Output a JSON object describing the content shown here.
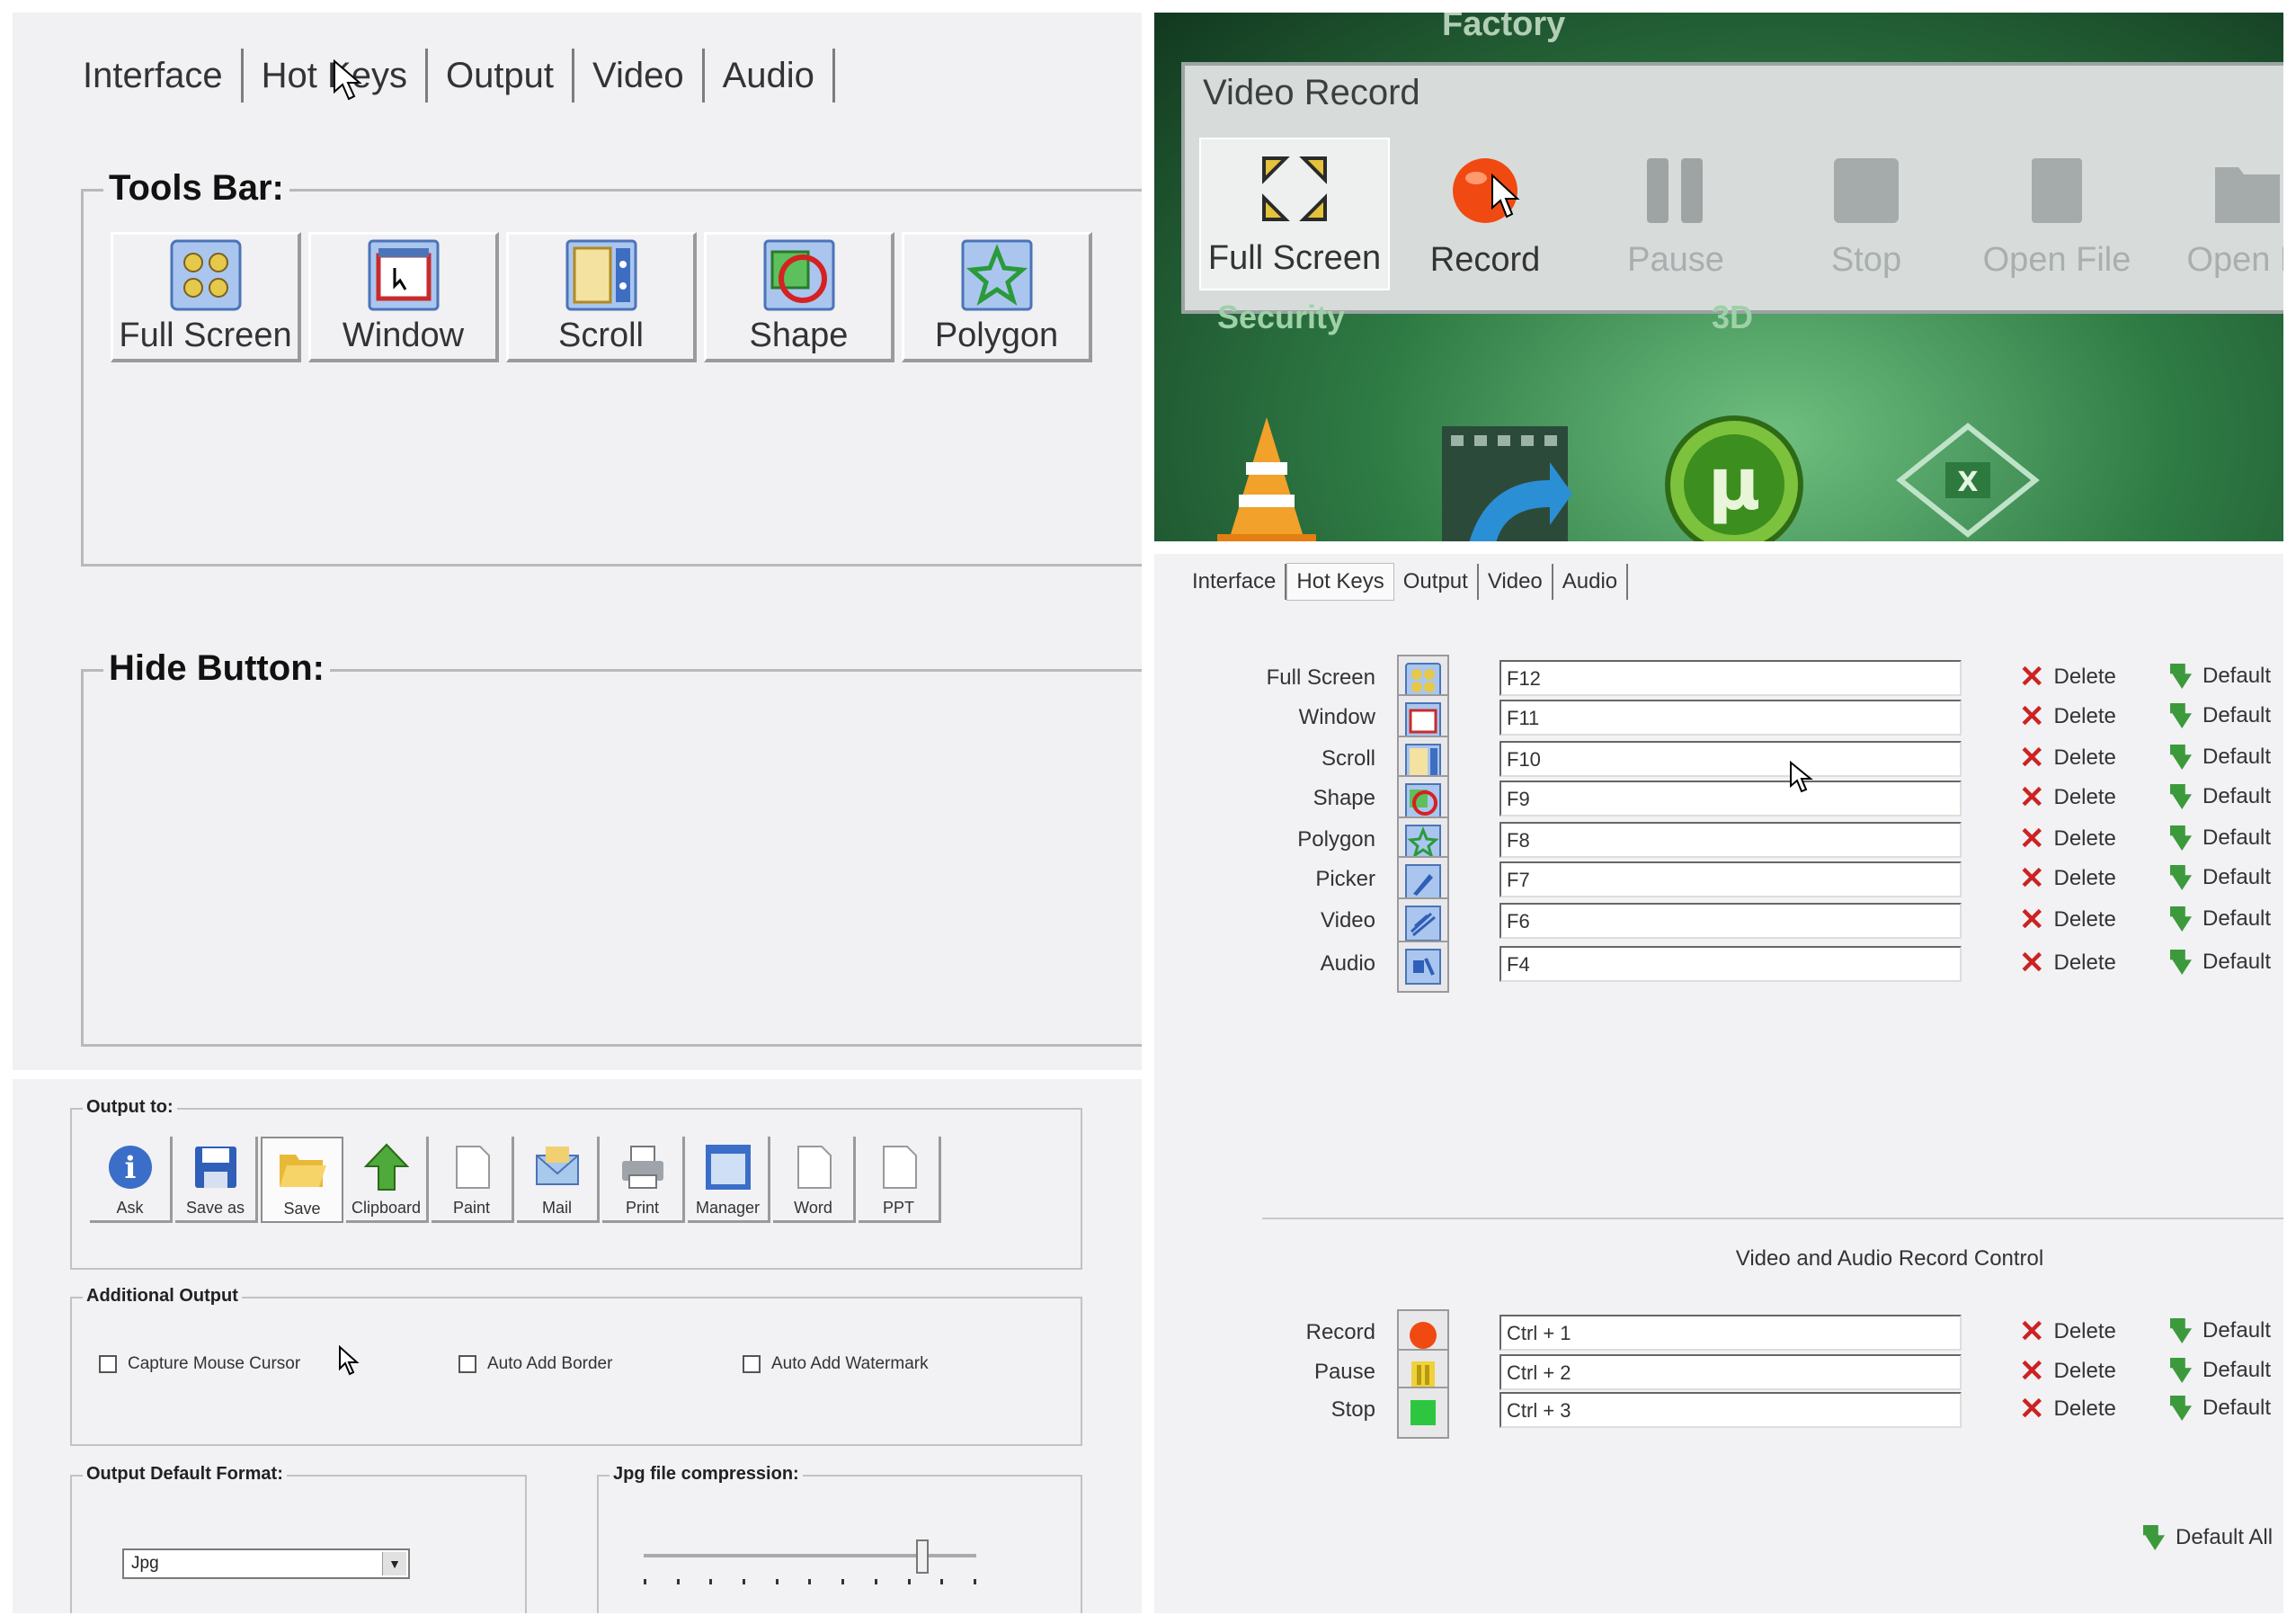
{
  "interface_panel": {
    "tabs": [
      "Interface",
      "Hot Keys",
      "Output",
      "Video",
      "Audio"
    ],
    "tools_bar_label": "Tools Bar:",
    "tools": [
      {
        "label": "Full Screen",
        "icon": "full-screen-icon"
      },
      {
        "label": "Window",
        "icon": "window-icon"
      },
      {
        "label": "Scroll",
        "icon": "scroll-icon"
      },
      {
        "label": "Shape",
        "icon": "shape-icon"
      },
      {
        "label": "Polygon",
        "icon": "polygon-icon"
      }
    ],
    "hide_button_label": "Hide Button:"
  },
  "video_record": {
    "title": "Video Record",
    "background_label": "Factory",
    "buttons": [
      {
        "label": "Full Screen",
        "icon": "full-screen-icon",
        "enabled": true
      },
      {
        "label": "Record",
        "icon": "record-icon",
        "enabled": true
      },
      {
        "label": "Pause",
        "icon": "pause-icon",
        "enabled": false
      },
      {
        "label": "Stop",
        "icon": "stop-icon",
        "enabled": false
      },
      {
        "label": "Open File",
        "icon": "open-file-icon",
        "enabled": false
      },
      {
        "label": "Open Fi",
        "icon": "open-folder-icon",
        "enabled": false
      }
    ],
    "desktop_labels": [
      "Security",
      "3D"
    ],
    "desktop_icons": [
      "vlc-icon",
      "video-converter-icon",
      "utorrent-icon",
      "excel-icon"
    ]
  },
  "output_panel": {
    "output_to_label": "Output to:",
    "output_buttons": [
      {
        "label": "Ask",
        "icon": "info-icon"
      },
      {
        "label": "Save as",
        "icon": "save-icon"
      },
      {
        "label": "Save",
        "icon": "folder-icon",
        "selected": true
      },
      {
        "label": "Clipboard",
        "icon": "clipboard-icon"
      },
      {
        "label": "Paint",
        "icon": "paint-icon"
      },
      {
        "label": "Mail",
        "icon": "mail-icon"
      },
      {
        "label": "Print",
        "icon": "printer-icon"
      },
      {
        "label": "Manager",
        "icon": "manager-icon"
      },
      {
        "label": "Word",
        "icon": "word-icon"
      },
      {
        "label": "PPT",
        "icon": "ppt-icon"
      }
    ],
    "additional_output_label": "Additional Output",
    "checkboxes": [
      {
        "label": "Capture Mouse Cursor",
        "checked": false
      },
      {
        "label": "Auto Add Border",
        "checked": false
      },
      {
        "label": "Auto Add Watermark",
        "checked": false
      }
    ],
    "default_format_label": "Output Default Format:",
    "default_format_value": "Jpg",
    "jpg_compression_label": "Jpg file compression:",
    "jpg_compression_level": 0.82
  },
  "hotkeys_panel": {
    "tabs": [
      "Interface",
      "Hot Keys",
      "Output",
      "Video",
      "Audio"
    ],
    "rows": [
      {
        "label": "Full Screen",
        "key": "F12",
        "icon": "full-screen-icon"
      },
      {
        "label": "Window",
        "key": "F11",
        "icon": "window-icon"
      },
      {
        "label": "Scroll",
        "key": "F10",
        "icon": "scroll-icon"
      },
      {
        "label": "Shape",
        "key": "F9",
        "icon": "shape-icon"
      },
      {
        "label": "Polygon",
        "key": "F8",
        "icon": "polygon-icon"
      },
      {
        "label": "Picker",
        "key": "F7",
        "icon": "picker-icon"
      },
      {
        "label": "Video",
        "key": "F6",
        "icon": "video-icon"
      },
      {
        "label": "Audio",
        "key": "F4",
        "icon": "audio-icon"
      }
    ],
    "section_title": "Video and Audio Record Control",
    "record_rows": [
      {
        "label": "Record",
        "key": "Ctrl + 1",
        "icon": "record-icon"
      },
      {
        "label": "Pause",
        "key": "Ctrl + 2",
        "icon": "pause-icon"
      },
      {
        "label": "Stop",
        "key": "Ctrl + 3",
        "icon": "stop-icon"
      }
    ],
    "delete_label": "Delete",
    "default_label": "Default",
    "default_all_label": "Default All"
  },
  "colors": {
    "record_red": "#f04a12",
    "desktop_green": "#2f7c45",
    "delete_red": "#cc2222",
    "default_green": "#3c9a3c"
  }
}
